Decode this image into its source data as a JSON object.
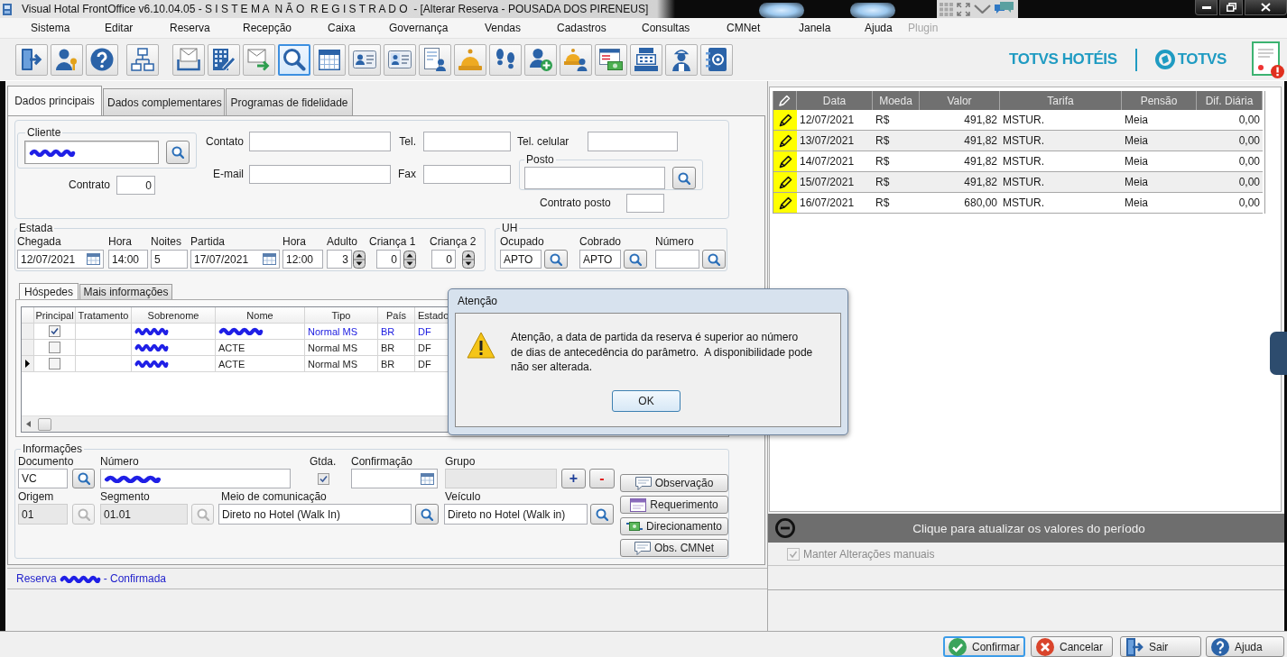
{
  "title_bar": {
    "title": "Visual Hotal FrontOffice v6.10.04.05 - S I S T E M A  N Ã O  R E G I S T R A D O  - [Alterar Reserva - POUSADA DOS PIRENEUS]"
  },
  "menu": [
    {
      "label": "Sistema",
      "disabled": false
    },
    {
      "label": "Editar",
      "disabled": false
    },
    {
      "label": "Reserva",
      "disabled": false
    },
    {
      "label": "Recepção",
      "disabled": false
    },
    {
      "label": "Caixa",
      "disabled": false
    },
    {
      "label": "Governança",
      "disabled": false
    },
    {
      "label": "Vendas",
      "disabled": false
    },
    {
      "label": "Cadastros",
      "disabled": false
    },
    {
      "label": "Consultas",
      "disabled": false
    },
    {
      "label": "CMNet",
      "disabled": false
    },
    {
      "label": "Janela",
      "disabled": false
    },
    {
      "label": "Ajuda",
      "disabled": false
    },
    {
      "label": "Plugin",
      "disabled": true
    }
  ],
  "toolbar": [
    {
      "buttons": [
        {
          "kind": "exit",
          "selected": false
        },
        {
          "kind": "user-key",
          "selected": false
        },
        {
          "kind": "help",
          "selected": false
        }
      ]
    },
    {
      "buttons": [
        {
          "kind": "org-chart",
          "selected": false
        }
      ]
    },
    {
      "buttons": [
        {
          "kind": "mail-tray",
          "selected": false
        },
        {
          "kind": "building-pen",
          "selected": false
        },
        {
          "kind": "mail-send",
          "selected": false
        },
        {
          "kind": "search",
          "selected": true
        },
        {
          "kind": "calendar",
          "selected": false
        },
        {
          "kind": "id-card",
          "selected": false
        },
        {
          "kind": "id-card-photo",
          "selected": false
        },
        {
          "kind": "document-person",
          "selected": false
        },
        {
          "kind": "bell",
          "selected": false
        },
        {
          "kind": "footprints",
          "selected": false
        },
        {
          "kind": "user-add",
          "selected": false
        },
        {
          "kind": "bell-people",
          "selected": false
        },
        {
          "kind": "window-money",
          "selected": false
        },
        {
          "kind": "cash-register",
          "selected": false
        },
        {
          "kind": "maid",
          "selected": false
        },
        {
          "kind": "address-book",
          "selected": false
        }
      ]
    }
  ],
  "brand": {
    "product": "TOTVS HOTÉIS",
    "company": "TOTVS"
  },
  "tabs": [
    {
      "label": "Dados principais",
      "selected": true
    },
    {
      "label": "Dados complementares",
      "selected": false
    },
    {
      "label": "Programas de fidelidade",
      "selected": false
    }
  ],
  "main_form": {
    "cliente": {
      "legend": "Cliente",
      "redacted": true
    },
    "contrato": {
      "label": "Contrato",
      "value": "0"
    },
    "contato": {
      "label": "Contato"
    },
    "tel": {
      "label": "Tel."
    },
    "tel_celular": {
      "label": "Tel. celular"
    },
    "email": {
      "label": "E-mail"
    },
    "fax": {
      "label": "Fax"
    },
    "posto": {
      "legend": "Posto"
    },
    "contrato_posto": {
      "label": "Contrato posto"
    }
  },
  "estada": {
    "legend": "Estada",
    "fields": [
      {
        "kind": "date",
        "label": "Chegada",
        "value": "12/07/2021"
      },
      {
        "kind": "text",
        "label": "Hora",
        "value": "14:00"
      },
      {
        "kind": "text",
        "label": "Noites",
        "value": "5"
      },
      {
        "kind": "date",
        "label": "Partida",
        "value": "17/07/2021"
      },
      {
        "kind": "text",
        "label": "Hora",
        "value": "12:00"
      },
      {
        "kind": "spin",
        "label": "Adulto",
        "value": "3"
      },
      {
        "kind": "spin",
        "label": "Criança 1",
        "value": "0"
      },
      {
        "kind": "spin",
        "label": "Criança 2",
        "value": "0"
      }
    ]
  },
  "uh": {
    "legend": "UH",
    "fields": [
      {
        "label": "Ocupado",
        "value": "APTO"
      },
      {
        "label": "Cobrado",
        "value": "APTO"
      },
      {
        "label": "Número"
      }
    ]
  },
  "guests": {
    "tabs": [
      {
        "label": "Hóspedes",
        "selected": true
      },
      {
        "label": "Mais informações",
        "selected": false
      }
    ],
    "columns": [
      "Principal",
      "Tratamento",
      "Sobrenome",
      "Nome",
      "Tipo",
      "País",
      "Estado"
    ],
    "rows": [
      {
        "current": false,
        "principal": true,
        "surname_redacted": true,
        "name_redacted": true,
        "tipo": "Normal MS",
        "pais": "BR",
        "estado": "DF"
      },
      {
        "current": false,
        "principal": false,
        "surname_redacted": true,
        "name_redacted": false,
        "nome": "ACTE",
        "tipo": "Normal MS",
        "pais": "BR",
        "estado": "DF"
      },
      {
        "current": true,
        "principal": false,
        "surname_redacted": true,
        "name_redacted": false,
        "nome": "ACTE",
        "tipo": "Normal MS",
        "pais": "BR",
        "estado": "DF"
      }
    ]
  },
  "informacoes": {
    "legend": "Informações",
    "documento": {
      "label": "Documento",
      "value": "VC",
      "disabled": false
    },
    "numero": {
      "label": "Número",
      "redacted": true
    },
    "gtda": {
      "label": "Gtda.",
      "checked": true
    },
    "confirmacao": {
      "label": "Confirmação"
    },
    "grupo": {
      "label": "Grupo",
      "disabled": true
    },
    "add": "+",
    "remove": "-",
    "origem": {
      "label": "Origem",
      "value": "01",
      "disabled": true
    },
    "segmento": {
      "label": "Segmento",
      "value": "01.01",
      "disabled": true
    },
    "meio": {
      "label": "Meio de comunicação",
      "value": "Direto no Hotel (Walk In)",
      "disabled": false
    },
    "veiculo": {
      "label": "Veículo",
      "value": "Direto no Hotel (Walk in)",
      "disabled": false
    },
    "buttons": [
      {
        "kind": "note",
        "label": "Observação"
      },
      {
        "kind": "request",
        "label": "Requerimento"
      },
      {
        "kind": "routing",
        "label": "Direcionamento"
      },
      {
        "kind": "note",
        "label": "Obs. CMNet"
      }
    ]
  },
  "status": {
    "prefix": "Reserva",
    "redacted": true,
    "suffix": "- Confirmada"
  },
  "dialog": {
    "title": "Atenção",
    "message": "Atenção, a data de partida da reserva é superior ao número\nde dias de antecedência do parâmetro.  A disponibilidade pode\nnão ser alterada.",
    "button": "OK"
  },
  "rates": {
    "columns": [
      "Data",
      "Moeda",
      "Valor",
      "Tarifa",
      "Pensão",
      "Dif. Diária"
    ],
    "rows": [
      {
        "edited": true,
        "data": "12/07/2021",
        "moeda": "R$",
        "valor": "491,82",
        "tarifa": "MSTUR.",
        "pensao": "Meia",
        "dif": "0,00"
      },
      {
        "edited": true,
        "data": "13/07/2021",
        "moeda": "R$",
        "valor": "491,82",
        "tarifa": "MSTUR.",
        "pensao": "Meia",
        "dif": "0,00"
      },
      {
        "edited": true,
        "data": "14/07/2021",
        "moeda": "R$",
        "valor": "491,82",
        "tarifa": "MSTUR.",
        "pensao": "Meia",
        "dif": "0,00"
      },
      {
        "edited": true,
        "data": "15/07/2021",
        "moeda": "R$",
        "valor": "491,82",
        "tarifa": "MSTUR.",
        "pensao": "Meia",
        "dif": "0,00"
      },
      {
        "edited": true,
        "data": "16/07/2021",
        "moeda": "R$",
        "valor": "680,00",
        "tarifa": "MSTUR.",
        "pensao": "Meia",
        "dif": "0,00"
      }
    ]
  },
  "refresh_bar": {
    "label": "Clique para atualizar os valores do período"
  },
  "keep_manual": {
    "label": "Manter Alterações manuais",
    "checked": true,
    "disabled": true
  },
  "actions": [
    {
      "kind": "confirm",
      "label": "Confirmar",
      "focused": true
    },
    {
      "kind": "cancel",
      "label": "Cancelar",
      "focused": false
    },
    {
      "kind": "exit",
      "label": "Sair",
      "focused": false
    },
    {
      "kind": "help",
      "label": "Ajuda",
      "focused": false
    }
  ]
}
